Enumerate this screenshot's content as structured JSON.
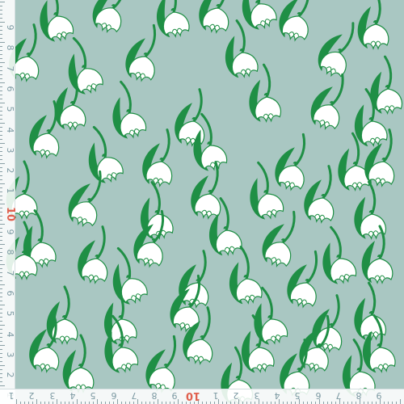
{
  "image": {
    "subject": "snowdrop-fabric-print",
    "background_color": "#a9c7c2",
    "leaf_color": "#1f8f45",
    "petal_color": "#ffffff"
  },
  "ruler_left": {
    "labels": [
      "9",
      "8",
      "7",
      "6",
      "5",
      "4",
      "3",
      "2",
      "1",
      "10",
      "9",
      "8",
      "7",
      "6",
      "5",
      "4",
      "3",
      "2",
      "1"
    ]
  },
  "ruler_bottom": {
    "labels": [
      "1",
      "2",
      "3",
      "4",
      "5",
      "6",
      "7",
      "8",
      "9",
      "10",
      "1",
      "2",
      "3",
      "4",
      "5",
      "6",
      "7",
      "8",
      "9"
    ]
  },
  "colors": {
    "ruler_bg": "#ffffff",
    "ruler_text": "#7d9aa3",
    "ruler_accent": "#e0604e"
  }
}
